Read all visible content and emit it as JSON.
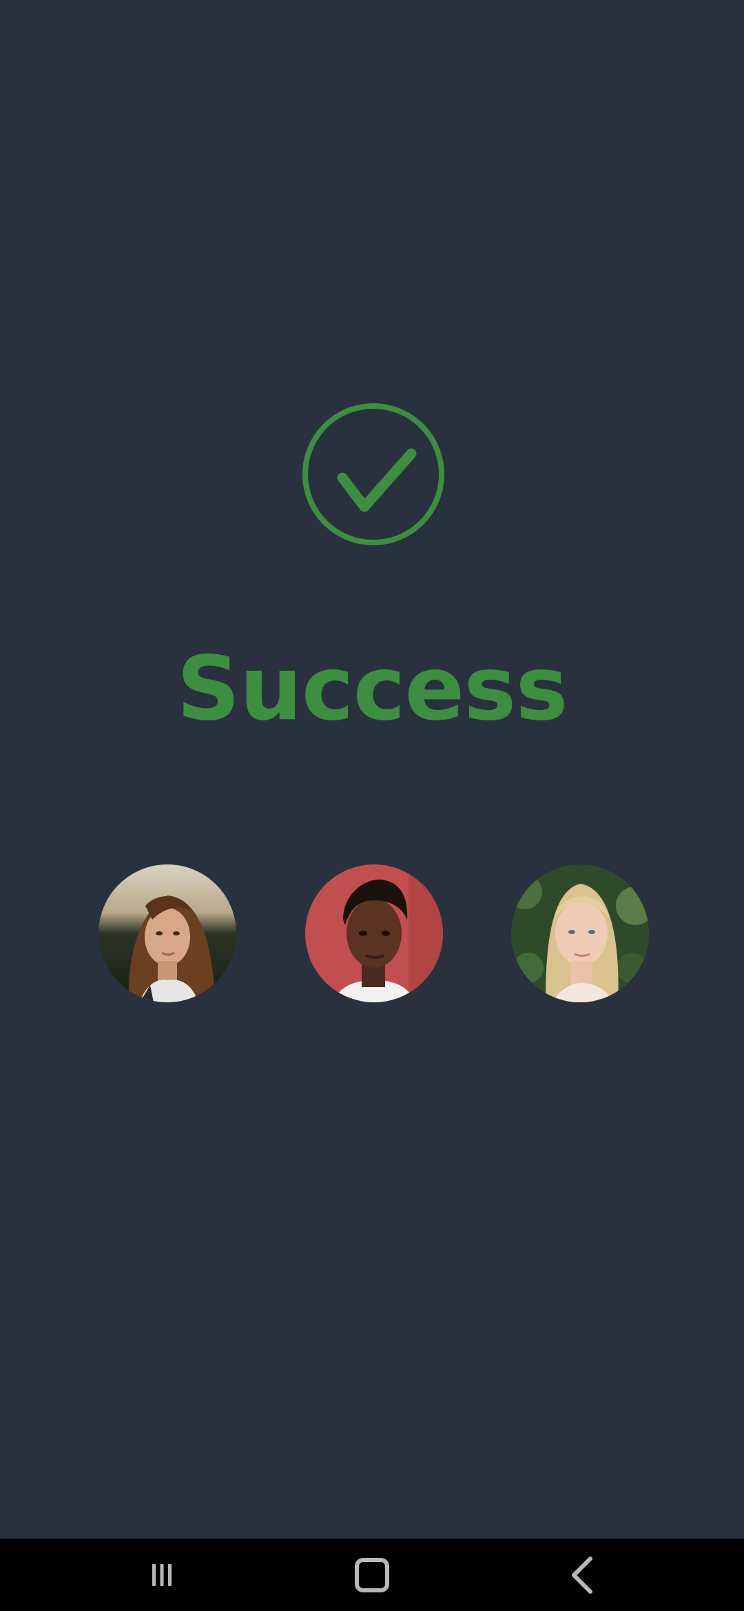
{
  "success": {
    "icon": "check-circle-icon",
    "title": "Success",
    "color": "#3e8e41"
  },
  "avatars": [
    {
      "name": "avatar-woman-long-brown-hair"
    },
    {
      "name": "avatar-woman-short-curly-hair"
    },
    {
      "name": "avatar-woman-blonde-hair"
    }
  ],
  "nav_bar": {
    "buttons": [
      {
        "icon": "recent-apps-icon"
      },
      {
        "icon": "home-icon"
      },
      {
        "icon": "back-icon"
      }
    ]
  },
  "colors": {
    "background": "#29303e",
    "accent": "#3e8e41",
    "nav_background": "#000000",
    "nav_icon": "#b8b8b8"
  }
}
